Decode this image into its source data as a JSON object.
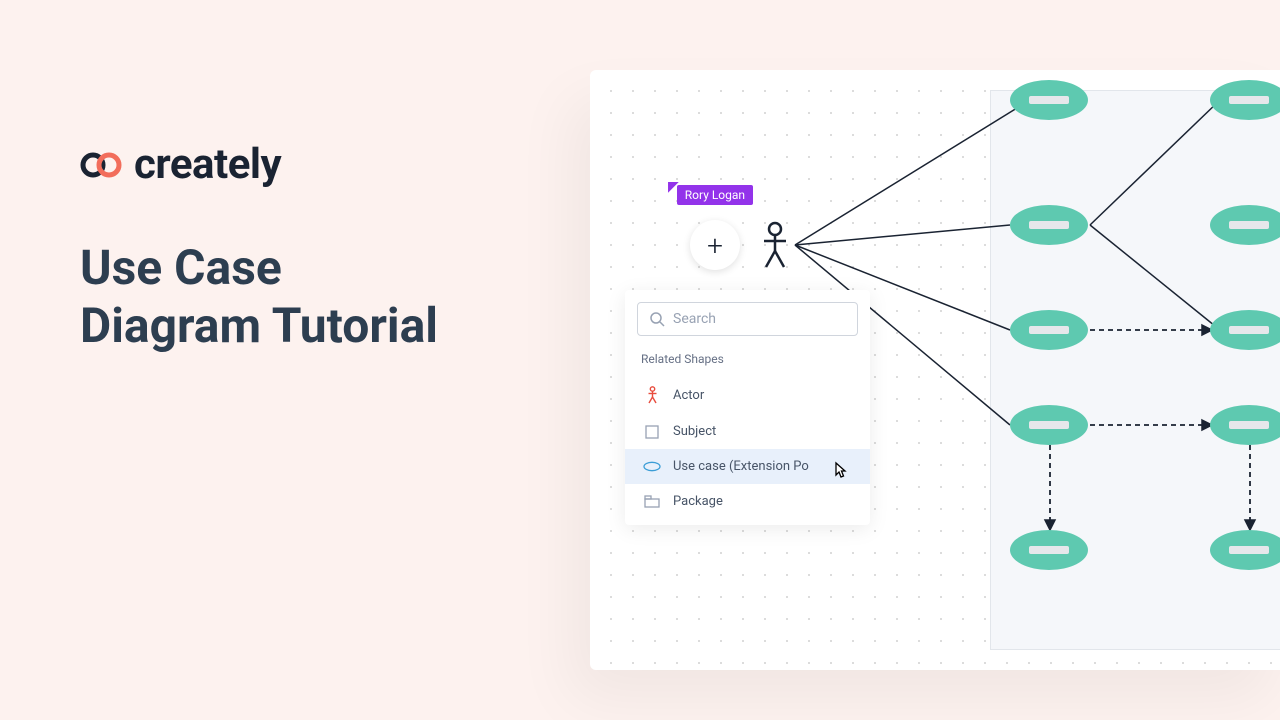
{
  "brand": {
    "name": "creately"
  },
  "title_line1": "Use Case",
  "title_line2": "Diagram Tutorial",
  "collaborator": {
    "name": "Rory Logan"
  },
  "search": {
    "placeholder": "Search"
  },
  "panel": {
    "header": "Related Shapes",
    "items": [
      {
        "label": "Actor",
        "icon": "actor",
        "selected": false
      },
      {
        "label": "Subject",
        "icon": "subject",
        "selected": false
      },
      {
        "label": "Use case (Extension Po",
        "icon": "usecase",
        "selected": true
      },
      {
        "label": "Package",
        "icon": "package",
        "selected": false
      }
    ]
  },
  "colors": {
    "accent": "#5ec9b0",
    "cursor_tag": "#9333ea",
    "text_dark": "#2d3e50"
  }
}
